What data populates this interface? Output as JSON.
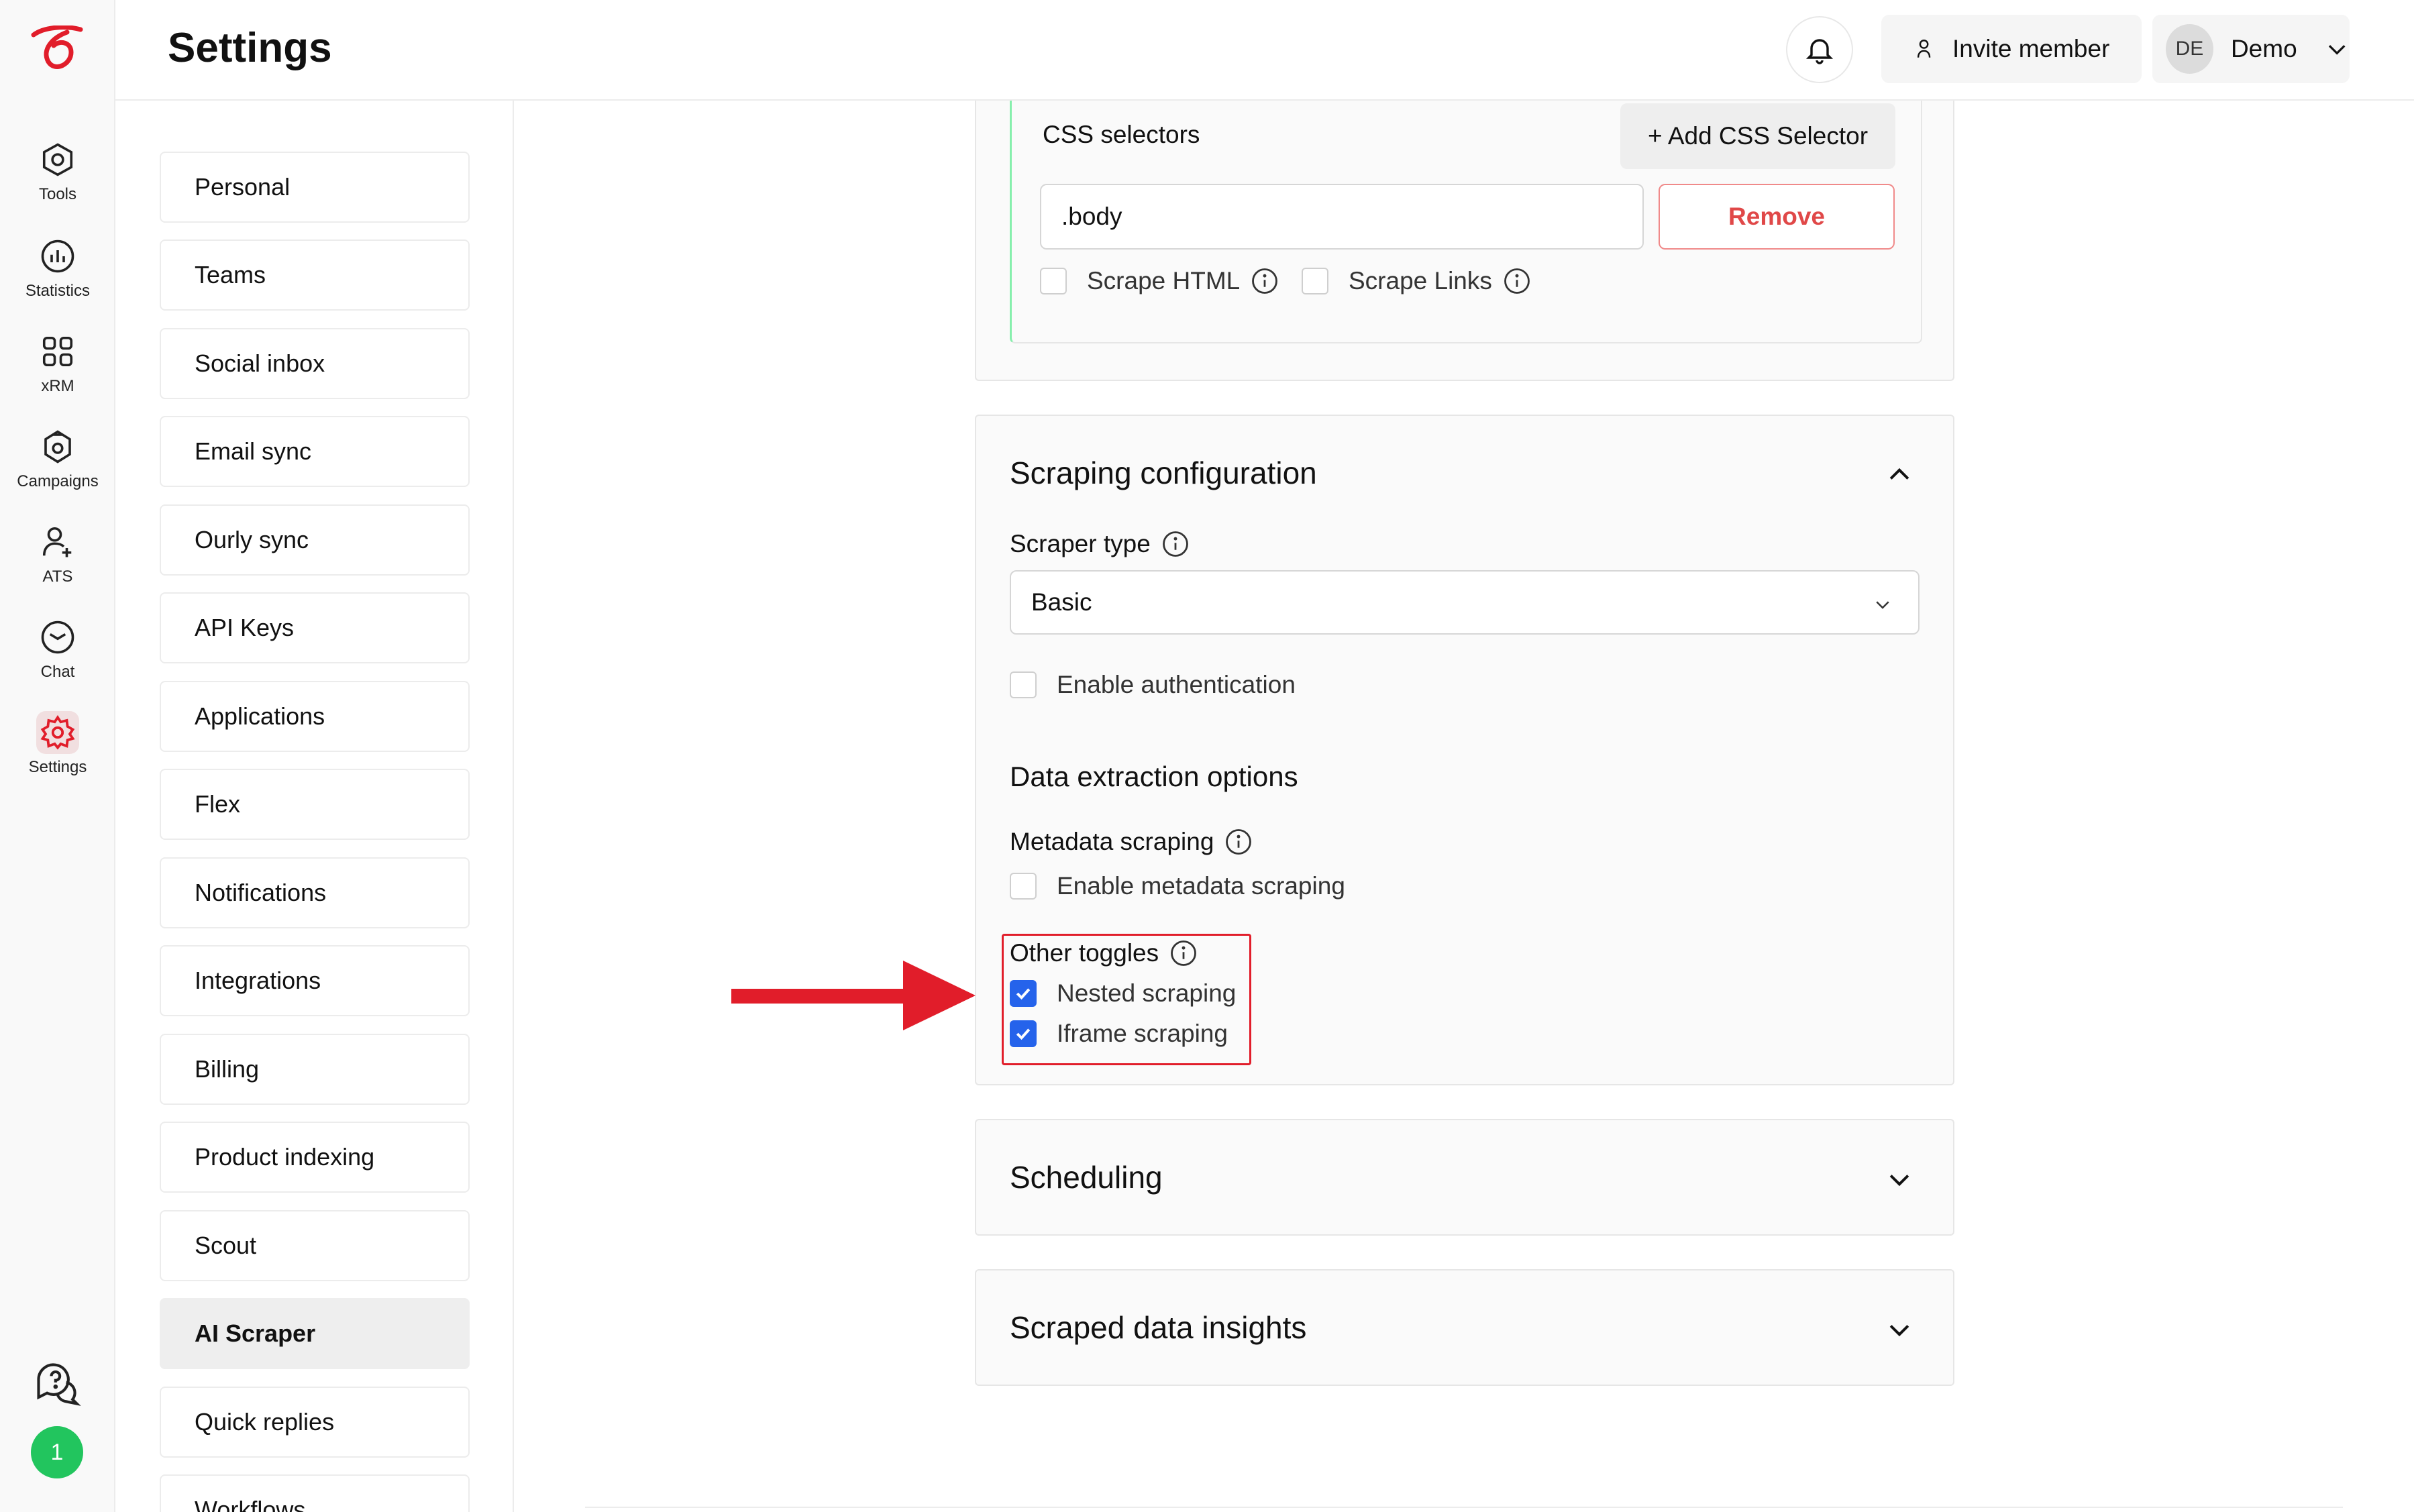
{
  "rail": {
    "items": [
      {
        "label": "Tools",
        "icon": "hexagon-icon"
      },
      {
        "label": "Statistics",
        "icon": "chart-icon"
      },
      {
        "label": "xRM",
        "icon": "grid-icon"
      },
      {
        "label": "Campaigns",
        "icon": "campaign-icon"
      },
      {
        "label": "ATS",
        "icon": "person-icon"
      },
      {
        "label": "Chat",
        "icon": "chat-bubble-icon"
      },
      {
        "label": "Settings",
        "icon": "gear-icon",
        "active": true
      }
    ],
    "badge_count": "1"
  },
  "header": {
    "title": "Settings",
    "invite_label": "Invite member",
    "user_initials": "DE",
    "user_name": "Demo"
  },
  "settings_nav": {
    "items": [
      "Personal",
      "Teams",
      "Social inbox",
      "Email sync",
      "Ourly sync",
      "API Keys",
      "Applications",
      "Flex",
      "Notifications",
      "Integrations",
      "Billing",
      "Product indexing",
      "Scout",
      "AI Scraper",
      "Quick replies",
      "Workflows"
    ],
    "active": "AI Scraper"
  },
  "css_selectors": {
    "title": "CSS selectors",
    "add_label": "+ Add CSS Selector",
    "input_value": ".body",
    "remove_label": "Remove",
    "scrape_html_label": "Scrape HTML",
    "scrape_html_checked": false,
    "scrape_links_label": "Scrape Links",
    "scrape_links_checked": false
  },
  "scraping_config": {
    "title": "Scraping configuration",
    "scraper_type_label": "Scraper type",
    "scraper_type_value": "Basic",
    "auth_label": "Enable authentication",
    "auth_checked": false,
    "extraction_title": "Data extraction options",
    "metadata_label": "Metadata scraping",
    "metadata_checkbox_label": "Enable metadata scraping",
    "metadata_checked": false,
    "other_toggles_label": "Other toggles",
    "nested_label": "Nested scraping",
    "nested_checked": true,
    "iframe_label": "Iframe scraping",
    "iframe_checked": true
  },
  "scheduling": {
    "title": "Scheduling"
  },
  "insights": {
    "title": "Scraped data insights"
  },
  "colors": {
    "brand": "#e11d2a",
    "checkbox_checked": "#2563eb",
    "remove_text": "#e04848",
    "badge": "#22c55e",
    "annotation": "#e11d2a"
  }
}
